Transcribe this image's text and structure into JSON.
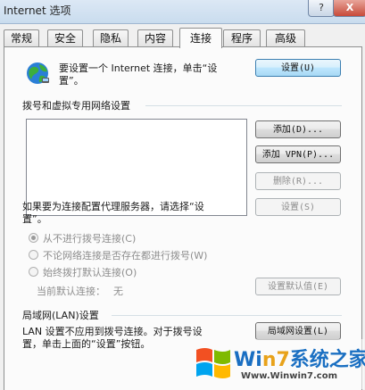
{
  "window": {
    "title": "Internet 选项",
    "help_label": "?",
    "close_label": "X"
  },
  "tabs": [
    {
      "label": "常规"
    },
    {
      "label": "安全"
    },
    {
      "label": "隐私"
    },
    {
      "label": "内容"
    },
    {
      "label": "连接"
    },
    {
      "label": "程序"
    },
    {
      "label": "高级"
    }
  ],
  "active_tab": "连接",
  "connect": {
    "setup_text_line1": "要设置一个 Internet 连接，单击“设",
    "setup_text_line2": "置”。",
    "setup_button": "设置(U)"
  },
  "dialup": {
    "group_title": "拨号和虚拟专用网络设置",
    "add_button": "添加(D)...",
    "add_vpn_button": "添加 VPN(P)...",
    "remove_button": "删除(R)...",
    "proxy_text_line1": "如果要为连接配置代理服务器，请选择“设",
    "proxy_text_line2": "置”。",
    "settings_button": "设置(S)",
    "radio_never": "从不进行拨号连接(C)",
    "radio_no_network": "不论网络连接是否存在都进行拨号(W)",
    "radio_always": "始终拨打默认连接(O)",
    "current_default_label": "当前默认连接：",
    "current_default_value": "无",
    "set_default_button": "设置默认值(E)"
  },
  "lan": {
    "group_title": "局域网(LAN)设置",
    "text_line1": "LAN 设置不应用到拨号连接。对于拨号设",
    "text_line2": "置，单击上面的“设置”按钮。",
    "lan_button": "局域网设置(L)"
  },
  "watermark": {
    "brand_prefix": "Wi",
    "brand_seven": "n7",
    "brand_suffix": "系统之家",
    "url": "Www.Winwin7.com"
  }
}
